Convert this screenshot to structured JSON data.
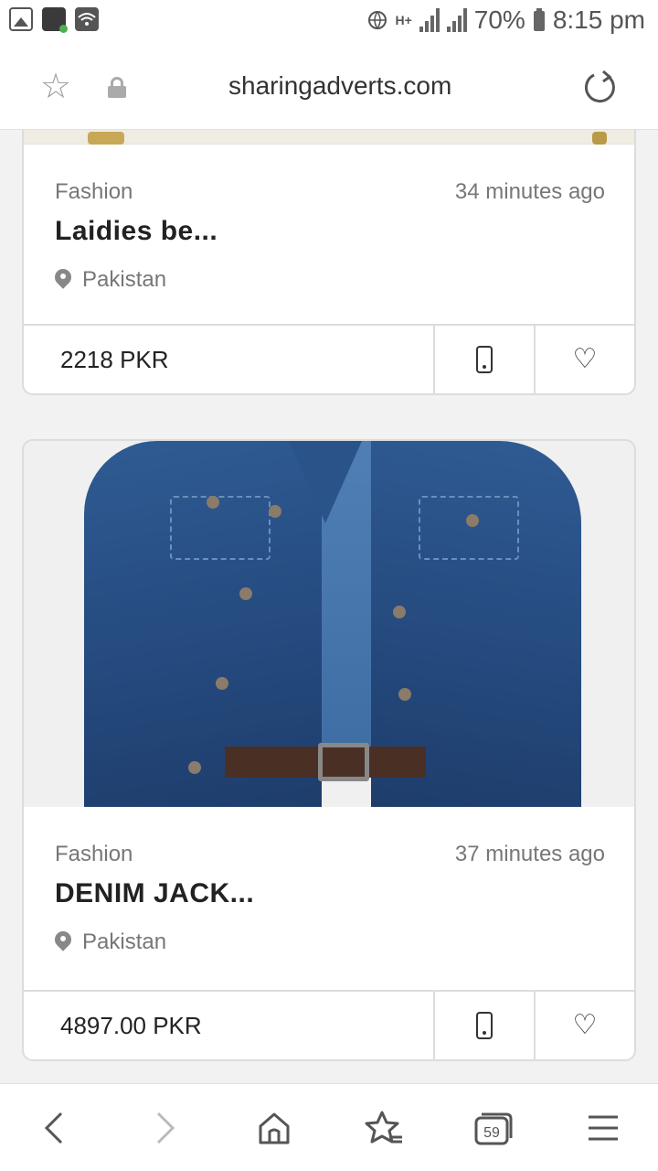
{
  "status_bar": {
    "network_label": "H+",
    "battery": "70%",
    "time": "8:15 pm"
  },
  "browser": {
    "url": "sharingadverts.com",
    "tab_count": "59"
  },
  "listings": [
    {
      "category": "Fashion",
      "time_ago": "34 minutes ago",
      "title": "Laidies be...",
      "location": "Pakistan",
      "price": "2218 PKR"
    },
    {
      "category": "Fashion",
      "time_ago": "37 minutes ago",
      "title": "DENIM JACK...",
      "location": "Pakistan",
      "price": "4897.00 PKR"
    }
  ],
  "icons": {
    "bookmark": "star-icon",
    "secure": "lock-icon",
    "reload": "reload-icon",
    "location": "location-pin-icon",
    "call": "phone-icon",
    "favorite": "heart-icon",
    "back": "back-icon",
    "forward": "forward-icon",
    "home": "home-icon",
    "bookmarks": "bookmarks-icon",
    "tabs": "tabs-icon",
    "menu": "menu-icon"
  }
}
